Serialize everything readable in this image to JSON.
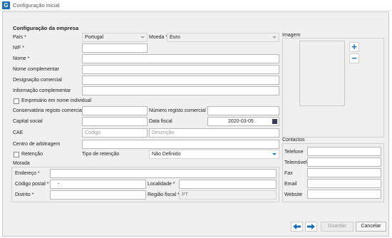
{
  "window": {
    "title": "Configuração inicial",
    "icon": "app-logo-icon"
  },
  "empresa": {
    "section_title": "Configuração da empresa",
    "pais_label": "País *",
    "pais_value": "Portugal",
    "moeda_label": "Moeda *",
    "moeda_value": "Euro",
    "nif_label": "NIF *",
    "nif_value": "",
    "nome_label": "Nome *",
    "nome_value": "",
    "nome_comp_label": "Nome complementar",
    "nome_comp_value": "",
    "designacao_label": "Designação comercial",
    "designacao_value": "",
    "info_comp_label": "Informação complementar",
    "info_comp_value": "",
    "empresario_label": "Empresário em nome individual",
    "empresario_checked": false,
    "conservatoria_label": "Conservatória registo comercial *",
    "conservatoria_value": "",
    "num_registo_label": "Número registo comercial *",
    "num_registo_value": "",
    "capital_label": "Capital social",
    "capital_value": "",
    "ano_fiscal_label": "Data fiscal",
    "ano_fiscal_value": "2020-03-05",
    "cae_label": "CAE",
    "cae_codigo_placeholder": "Código",
    "cae_descricao_placeholder": "Descrição",
    "centro_label": "Centro de arbitragem",
    "centro_value": "",
    "retencao_label": "Retenção",
    "retencao_checked": false,
    "tipo_retencao_label": "Tipo de retenção",
    "tipo_retencao_value": "Não Definido"
  },
  "imagem": {
    "section_title": "Imagem",
    "add_icon": "plus-icon",
    "remove_icon": "minus-icon",
    "add_glyph": "+",
    "remove_glyph": "−"
  },
  "morada": {
    "section_title": "Morada",
    "endereco_label": "Endereço *",
    "endereco_value": "",
    "codpostal_label": "Código postal *",
    "codpostal_value": "-",
    "localidade_label": "Localidade *",
    "localidade_value": "",
    "distrito_label": "Distrito *",
    "distrito_value": "",
    "regiao_label": "Região fiscal *",
    "regiao_value": "PT"
  },
  "contactos": {
    "section_title": "Contactos",
    "telefone_label": "Telefone",
    "telemovel_label": "Telemóvel",
    "fax_label": "Fax",
    "email_label": "Email",
    "website_label": "Website"
  },
  "footer": {
    "back_icon": "arrow-left-icon",
    "forward_icon": "arrow-right-icon",
    "save_label": "Guardar",
    "cancel_label": "Cancelar"
  },
  "colors": {
    "accent": "#1c6fb6",
    "panel_bg": "#f0f0f0"
  }
}
